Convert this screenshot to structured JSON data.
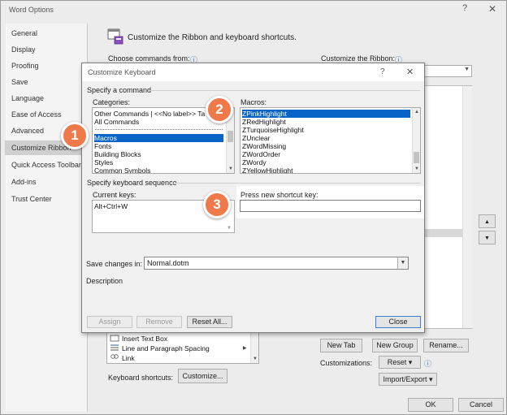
{
  "word_options": {
    "title": "Word Options",
    "help_glyph": "?",
    "close_glyph": "✕",
    "nav": [
      "General",
      "Display",
      "Proofing",
      "Save",
      "Language",
      "Ease of Access",
      "Advanced",
      "Customize Ribbon",
      "Quick Access Toolbar",
      "Add-ins",
      "Trust Center"
    ],
    "header": "Customize the Ribbon and keyboard shortcuts.",
    "choose_commands_label": "Choose commands from:",
    "customize_ribbon_label": "Customize the Ribbon:",
    "info_glyph": "ⓘ",
    "commands_list": [
      "Insert Text Box",
      "Line and Paragraph Spacing",
      "Link"
    ],
    "keyboard_shortcuts_label": "Keyboard shortcuts:",
    "customize_button": "Customize...",
    "new_tab": "New Tab",
    "new_group": "New Group",
    "rename": "Rename...",
    "customizations_label": "Customizations:",
    "reset": "Reset ▾",
    "import_export": "Import/Export ▾",
    "ok": "OK",
    "cancel": "Cancel"
  },
  "customize_keyboard": {
    "title": "Customize Keyboard",
    "help_glyph": "?",
    "close_glyph": "✕",
    "specify_command": "Specify a command",
    "categories_label": "Categories:",
    "categories": [
      "Other Commands | <<No label>> Ta",
      "All Commands",
      "",
      "Macros",
      "Fonts",
      "Building Blocks",
      "Styles",
      "Common Symbols"
    ],
    "macros_label": "Macros:",
    "macros": [
      "ZPinkHighlight",
      "ZRedHighlight",
      "ZTurquoiseHighlight",
      "ZUnclear",
      "ZWordMissing",
      "ZWordOrder",
      "ZWordy",
      "ZYellowHighlight"
    ],
    "specify_sequence": "Specify keyboard sequence",
    "current_keys_label": "Current keys:",
    "current_keys": [
      "Alt+Ctrl+W"
    ],
    "press_new_label": "Press new shortcut key:",
    "press_new_value": "",
    "save_changes_label": "Save changes in:",
    "save_changes_value": "Normal.dotm",
    "description_label": "Description",
    "assign": "Assign",
    "remove": "Remove",
    "reset_all": "Reset All...",
    "close": "Close"
  },
  "callouts": [
    "1",
    "2",
    "3"
  ],
  "colors": {
    "accent_blue": "#0a64c8",
    "callout_orange": "#f0794a",
    "default_button_border": "#3c7fd1"
  }
}
